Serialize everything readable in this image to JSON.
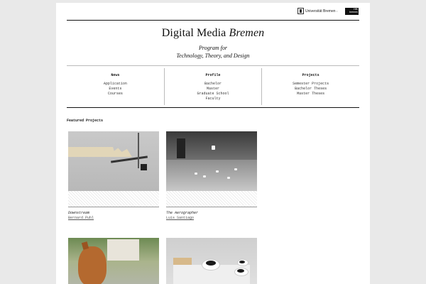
{
  "header": {
    "university_logo_text": "Universität Bremen",
    "hfk_logo_text": "HfK bremen",
    "separator": "•"
  },
  "site": {
    "title_main": "Digital Media",
    "title_accent": "Bremen",
    "subtitle_line1": "Program for",
    "subtitle_line2": "Technology, Theory, and Design"
  },
  "nav": {
    "news": {
      "heading": "News",
      "items": [
        "Application",
        "Events",
        "Courses"
      ]
    },
    "profile": {
      "heading": "Profile",
      "items": [
        "Bachelor",
        "Master",
        "Graduate School",
        "Faculty"
      ]
    },
    "projects": {
      "heading": "Projects",
      "items": [
        "Semester Projects",
        "Bachelor Theses",
        "Master Theses"
      ]
    }
  },
  "featured": {
    "heading": "Featured Projects",
    "cards": [
      {
        "title": "Downstream",
        "author": "Bernard Puhl",
        "icon": "image-thumbnail"
      },
      {
        "title": "The Aerographer",
        "author": "Luis Santiago",
        "icon": "image-thumbnail"
      },
      {
        "title": "",
        "author": "",
        "icon": "image-thumbnail"
      },
      {
        "title": "",
        "author": "",
        "icon": "image-thumbnail"
      }
    ]
  },
  "colors": {
    "background": "#e9e9e9",
    "page": "#ffffff",
    "rule": "#111111",
    "link": "#555555"
  }
}
